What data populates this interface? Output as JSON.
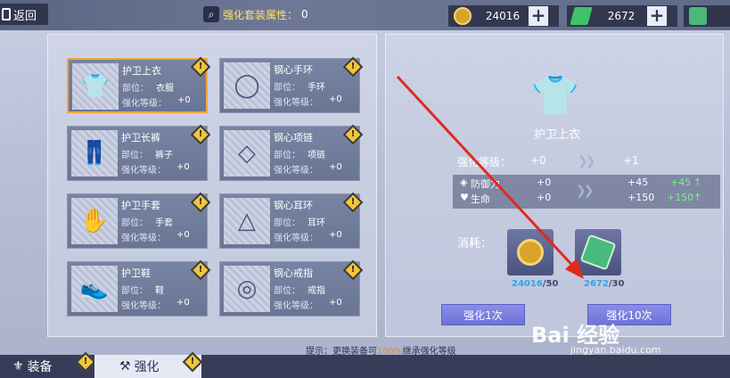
{
  "topbar": {
    "back_label": "返回",
    "attr_label": "强化套装属性：",
    "attr_value": "0",
    "currencies": [
      {
        "icon": "gold-coin-icon",
        "value": "24016",
        "color": "#d9a42a"
      },
      {
        "icon": "green-arrow-icon",
        "value": "2672",
        "color": "#3fc36a"
      },
      {
        "icon": "green-gem-icon",
        "value": "",
        "color": "#49b97c"
      }
    ],
    "plus": "+"
  },
  "cards": [
    {
      "name": "护卫上衣",
      "part_label": "部位：",
      "part": "衣服",
      "level_label": "强化等级：",
      "level": "+0",
      "icon": "shirt-icon",
      "glyph": "👕",
      "selected": true
    },
    {
      "name": "钢心手环",
      "part_label": "部位：",
      "part": "手环",
      "level_label": "强化等级：",
      "level": "+0",
      "icon": "bracelet-icon",
      "glyph": "◯"
    },
    {
      "name": "护卫长裤",
      "part_label": "部位：",
      "part": "裤子",
      "level_label": "强化等级：",
      "level": "+0",
      "icon": "pants-icon",
      "glyph": "👖"
    },
    {
      "name": "钢心项链",
      "part_label": "部位：",
      "part": "项链",
      "level_label": "强化等级：",
      "level": "+0",
      "icon": "necklace-icon",
      "glyph": "◇"
    },
    {
      "name": "护卫手套",
      "part_label": "部位：",
      "part": "手套",
      "level_label": "强化等级：",
      "level": "+0",
      "icon": "gloves-icon",
      "glyph": "✋"
    },
    {
      "name": "钢心耳环",
      "part_label": "部位：",
      "part": "耳环",
      "level_label": "强化等级：",
      "level": "+0",
      "icon": "earring-icon",
      "glyph": "△"
    },
    {
      "name": "护卫鞋",
      "part_label": "部位：",
      "part": "鞋",
      "level_label": "强化等级：",
      "level": "+0",
      "icon": "shoe-icon",
      "glyph": "👟"
    },
    {
      "name": "钢心戒指",
      "part_label": "部位：",
      "part": "戒指",
      "level_label": "强化等级：",
      "level": "+0",
      "icon": "ring-icon",
      "glyph": "◎"
    }
  ],
  "detail": {
    "item_name": "护卫上衣",
    "level_label": "强化等级：",
    "level_from": "+0",
    "level_to": "+1",
    "stats": [
      {
        "name": "防御力",
        "from": "+0",
        "to": "+45",
        "gain": "+45",
        "icon": "shield-icon"
      },
      {
        "name": "生命",
        "from": "+0",
        "to": "+150",
        "gain": "+150",
        "icon": "heart-icon"
      }
    ],
    "consume_label": "消耗：",
    "materials": [
      {
        "icon": "gold-coin-icon",
        "have": "24016",
        "need": "/50"
      },
      {
        "icon": "green-gem-icon",
        "have": "2672",
        "need": "/30"
      }
    ],
    "btn_once": "强化1次",
    "btn_ten": "强化10次"
  },
  "tip": {
    "prefix": "提示：更换装备可",
    "pct": "100%",
    "suffix": "继承强化等级"
  },
  "tabs": [
    {
      "label": "装备"
    },
    {
      "label": "强化"
    }
  ],
  "watermark": {
    "main": "Bai 经验",
    "sub": "jingyan.baidu.com"
  }
}
